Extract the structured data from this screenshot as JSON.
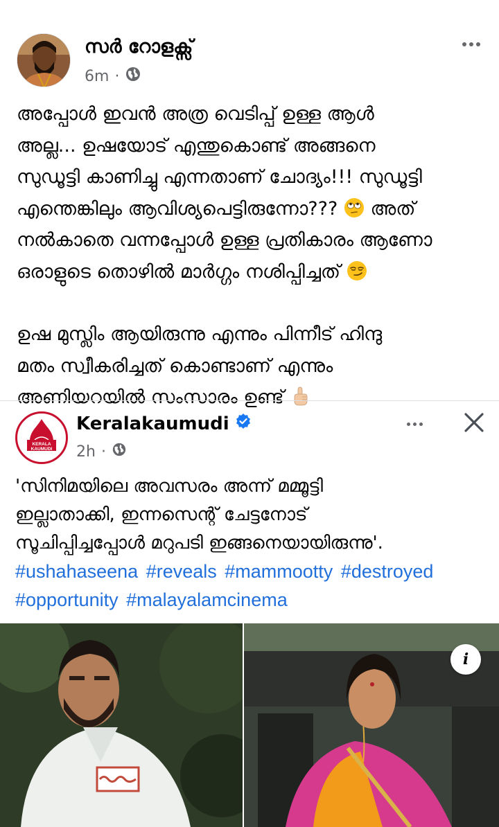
{
  "post": {
    "author": "സർ റോളക്സ്",
    "time": "6m",
    "audience_icon": "globe-icon",
    "more_icon": "more-dots-icon",
    "paragraph1": [
      "അപ്പോൾ ഇവൻ അത്ര വെടിപ്പ് ഉള്ള ആൾ",
      "അല്ല... ഉഷയോട് എന്തുകൊണ്ട് അങ്ങനെ",
      "സുഡൂട്ടി കാണിച്ചു എന്നതാണ് ചോദ്യം!!! സുഡൂട്ടി",
      "എന്തെങ്കിലും ആവിശ്യപെട്ടിരുന്നോ???",
      "അത്",
      "നൽകാതെ വന്നപ്പോൾ ഉള്ള പ്രതികാരം ആണോ",
      "ഒരാളുടെ തൊഴിൽ മാർഗ്ഗം നശിപ്പിച്ചത്"
    ],
    "paragraph2": [
      "ഉഷ മുസ്ലിം ആയിരുന്നു എന്നും പിന്നീട് ഹിന്ദു",
      "മതം സ്വീകരിച്ചത് കൊണ്ടാണ് എന്നും",
      "അണിയറയിൽ സംസാരം ഉണ്ട്"
    ],
    "emojis": [
      "face-with-rolling-eyes-emoji",
      "smirking-face-emoji",
      "hand-pointing-up-emoji"
    ]
  },
  "shared": {
    "page_name": "Keralakaumudi",
    "logo_text": "KERALA KAUMUDI",
    "time": "2h",
    "verified_icon": "verified-badge-icon",
    "close_icon": "close-icon",
    "headline": [
      "'സിനിമയിലെ അവസരം അന്ന് മമ്മൂട്ടി",
      "ഇല്ലാതാക്കി, ഇന്നസെന്റ് ചേട്ടനോട്",
      "സൂചിപ്പിച്ചപ്പോൾ മറുപടി ഇങ്ങനെയായിരുന്നു'."
    ],
    "hashtags_line1": [
      "#ushahaseena",
      "#reveals",
      "#mammootty",
      "#destroyed"
    ],
    "hashtags_line2": [
      "#opportunity",
      "#malayalamcinema"
    ],
    "info_label": "i"
  },
  "colors": {
    "text": "#050505",
    "meta": "#65676b",
    "link": "#216fdb",
    "verified": "#1877f2",
    "brand_red": "#c8102e"
  }
}
